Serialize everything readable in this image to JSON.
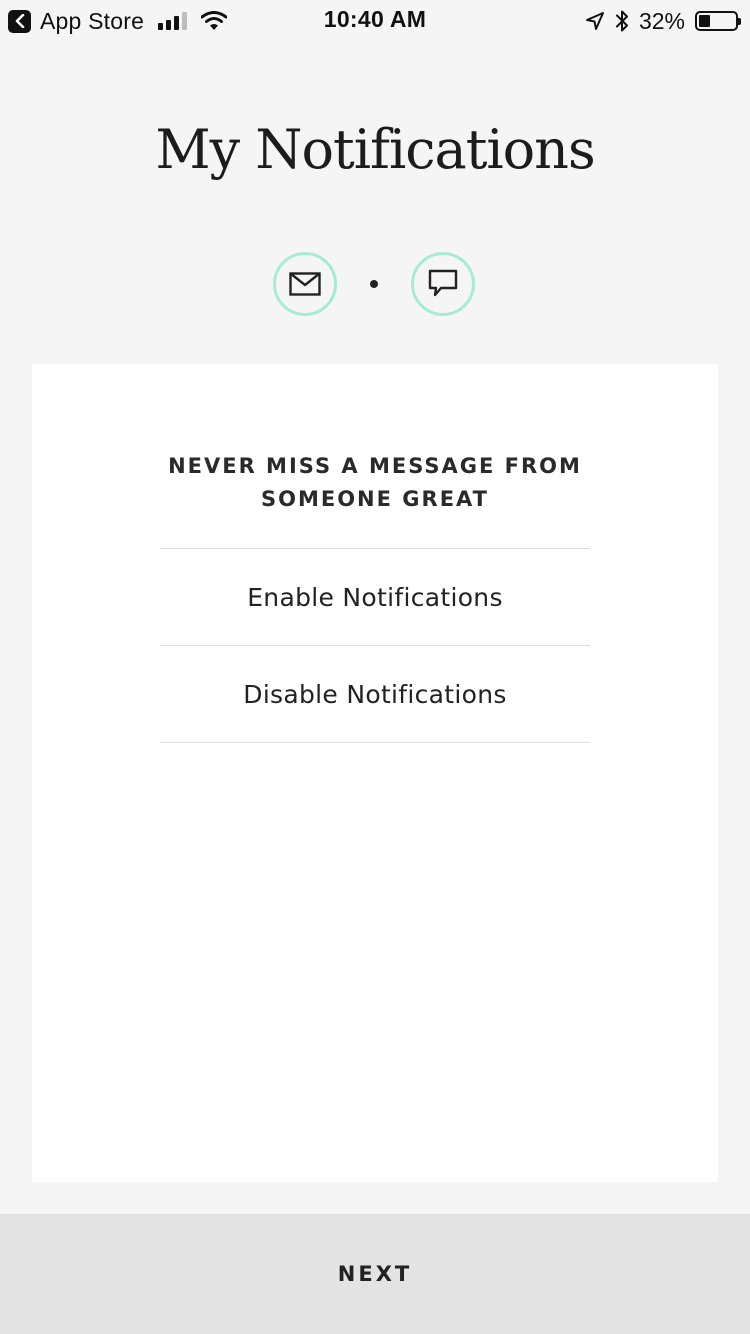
{
  "status_bar": {
    "back_app": "App Store",
    "time": "10:40 AM",
    "battery_percent": "32%",
    "battery_level": 0.32,
    "signal_bars_active": 3,
    "signal_bars_total": 4,
    "icons": [
      "back-arrow-icon",
      "signal-icon",
      "wifi-icon",
      "location-arrow-icon",
      "bluetooth-icon",
      "battery-icon"
    ]
  },
  "header": {
    "title": "My Notifications"
  },
  "progress": {
    "steps": [
      "mail-icon",
      "chat-bubble-icon"
    ],
    "accent_color": "#a6ebd6"
  },
  "card": {
    "heading_line1": "NEVER MISS A MESSAGE FROM",
    "heading_line2": "SOMEONE GREAT",
    "options": [
      {
        "label": "Enable Notifications"
      },
      {
        "label": "Disable Notifications"
      }
    ]
  },
  "footer": {
    "next_label": "NEXT"
  },
  "colors": {
    "background": "#f5f5f5",
    "card": "#ffffff",
    "button": "#e3e3e3",
    "accent": "#a6ebd6"
  }
}
